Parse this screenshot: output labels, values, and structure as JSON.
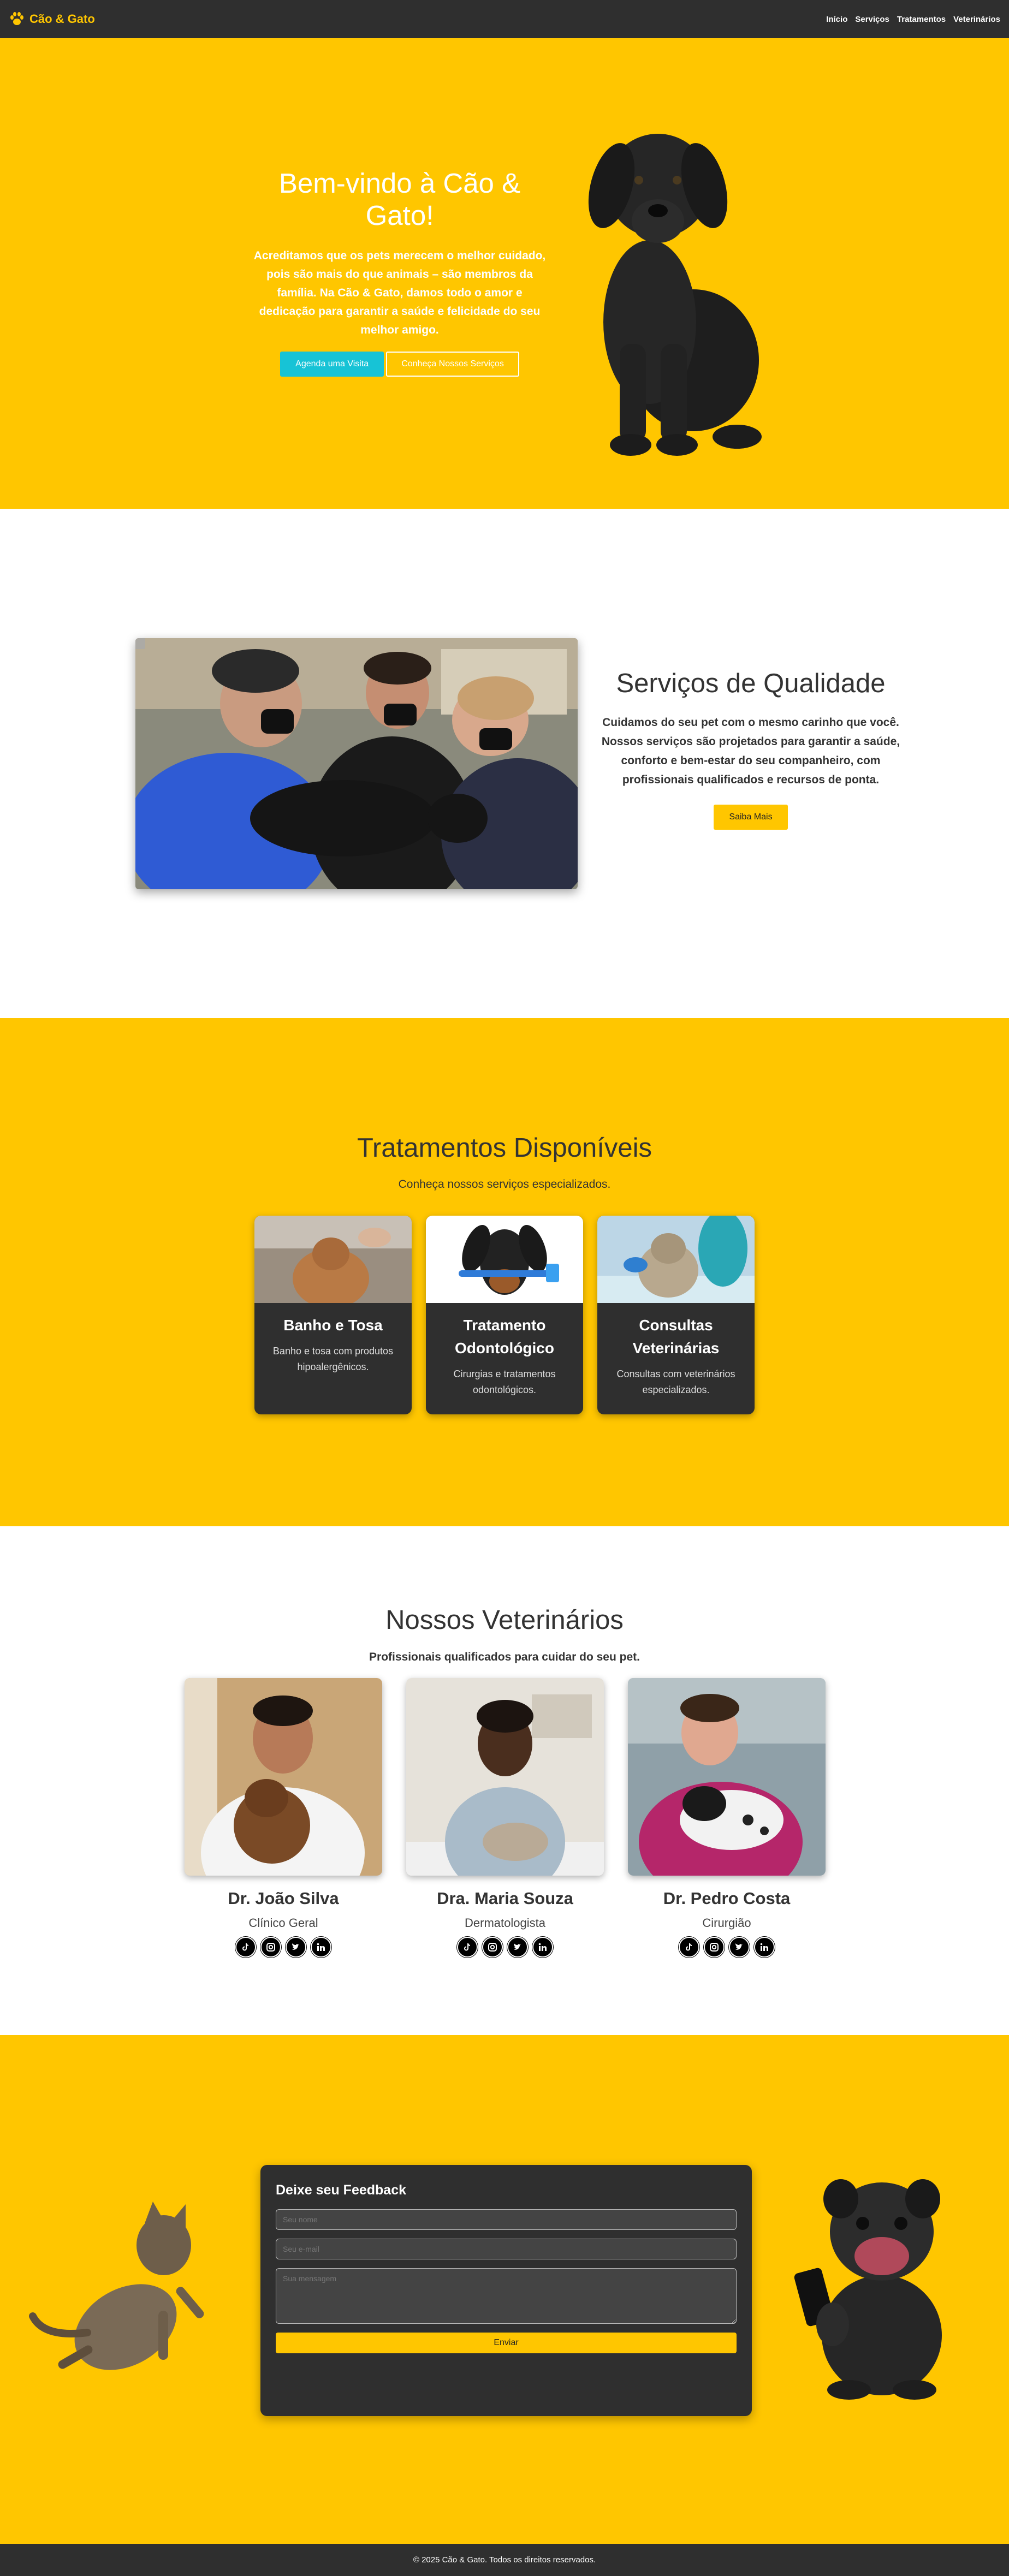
{
  "nav": {
    "brand": "Cão & Gato",
    "links": [
      "Início",
      "Serviços",
      "Tratamentos",
      "Veterinários"
    ]
  },
  "hero": {
    "title": "Bem-vindo à Cão & Gato!",
    "subtitle": "Acreditamos que os pets merecem o melhor cuidado, pois são mais do que animais – são membros da família. Na Cão & Gato, damos todo o amor e dedicação para garantir a saúde e felicidade do seu melhor amigo.",
    "btn_primary": "Agenda uma Visita",
    "btn_secondary": "Conheça Nossos Serviços"
  },
  "services": {
    "title": "Serviços de Qualidade",
    "description": "Cuidamos do seu pet com o mesmo carinho que você. Nossos serviços são projetados para garantir a saúde, conforto e bem-estar do seu companheiro, com profissionais qualificados e recursos de ponta.",
    "button": "Saiba Mais"
  },
  "treatments": {
    "title": "Tratamentos Disponíveis",
    "subtitle": "Conheça nossos serviços especializados.",
    "cards": [
      {
        "title": "Banho e Tosa",
        "desc": "Banho e tosa com produtos hipoalergênicos."
      },
      {
        "title": "Tratamento Odontológico",
        "desc": "Cirurgias e tratamentos odontológicos."
      },
      {
        "title": "Consultas Veterinárias",
        "desc": "Consultas com veterinários especializados."
      }
    ]
  },
  "vets": {
    "title": "Nossos Veterinários",
    "subtitle": "Profissionais qualificados para cuidar do seu pet.",
    "people": [
      {
        "name": "Dr. João Silva",
        "role": "Clínico Geral"
      },
      {
        "name": "Dra. Maria Souza",
        "role": "Dermatologista"
      },
      {
        "name": "Dr. Pedro Costa",
        "role": "Cirurgião"
      }
    ],
    "social_icons": [
      "tiktok-icon",
      "instagram-icon",
      "twitter-icon",
      "linkedin-icon"
    ]
  },
  "feedback": {
    "title": "Deixe seu Feedback",
    "name_placeholder": "Seu nome",
    "email_placeholder": "Seu e-mail",
    "message_placeholder": "Sua mensagem",
    "submit": "Enviar"
  },
  "footer": {
    "text": "© 2025 Cão & Gato. Todos os direitos reservados."
  },
  "colors": {
    "accent": "#ffc600",
    "dark": "#2f2f2f",
    "cyan": "#17c3d6"
  }
}
